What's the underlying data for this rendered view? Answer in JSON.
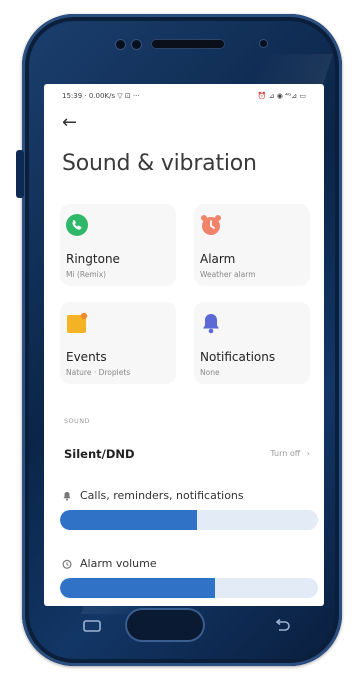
{
  "status_bar": {
    "left": "15:39 · 0.00K/s ▽ ⊡ ···",
    "right": "⏰ ⊿ ◉ ⁴ᴳ⊿ ▭"
  },
  "page": {
    "back_icon": "arrow-left-icon",
    "title": "Sound & vibration"
  },
  "cards": [
    {
      "label": "Ringtone",
      "sub": "Mi (Remix)",
      "icon": "phone-icon",
      "color": "#2fb86a"
    },
    {
      "label": "Alarm",
      "sub": "Weather alarm",
      "icon": "alarm-clock-icon",
      "color": "#f2836b"
    },
    {
      "label": "Events",
      "sub": "Nature · Droplets",
      "icon": "events-icon",
      "color": "#f4b324"
    },
    {
      "label": "Notifications",
      "sub": "None",
      "icon": "bell-icon",
      "color": "#5b6ad6"
    }
  ],
  "sound_section": {
    "header": "SOUND",
    "silent_dnd": {
      "label": "Silent/DND",
      "action": "Turn off"
    },
    "volumes": [
      {
        "label": "Calls, reminders, notifications",
        "icon": "bell-small-icon",
        "level": 0.53
      },
      {
        "label": "Alarm volume",
        "icon": "clock-small-icon",
        "level": 0.6
      }
    ]
  },
  "colors": {
    "accent": "#2f72c6",
    "slider_track": "#e2ebf6",
    "phone_body": "#0b2548"
  },
  "hardware": {
    "recents_icon": "recents-icon",
    "home_button": "home-button",
    "back_key_icon": "back-key-icon"
  }
}
